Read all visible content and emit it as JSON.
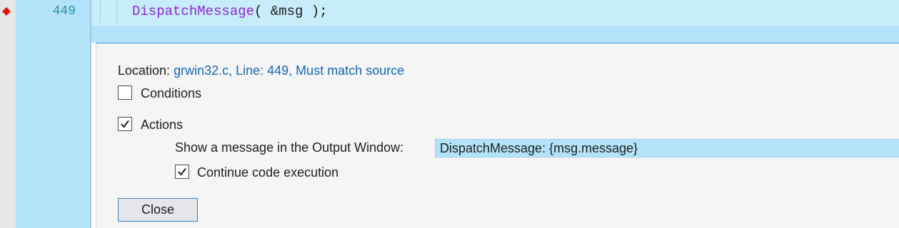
{
  "editor": {
    "line_number": "449",
    "code_function": "DispatchMessage",
    "code_rest": "( &msg );",
    "breakpoint_color": "#e51400"
  },
  "breakpoint_settings": {
    "location_label": "Location:",
    "location_value": "grwin32.c, Line: 449, Must match source",
    "conditions": {
      "label": "Conditions",
      "checked": false
    },
    "actions": {
      "label": "Actions",
      "checked": true
    },
    "message_label": "Show a message in the Output Window:",
    "message_value": "DispatchMessage: {msg.message}",
    "continue_execution": {
      "label": "Continue code execution",
      "checked": true
    },
    "close_label": "Close"
  },
  "colors": {
    "accent": "#3a9bd1",
    "highlight": "#b3e3f8",
    "link": "#1668b6",
    "function_name": "#8b2bd1"
  }
}
